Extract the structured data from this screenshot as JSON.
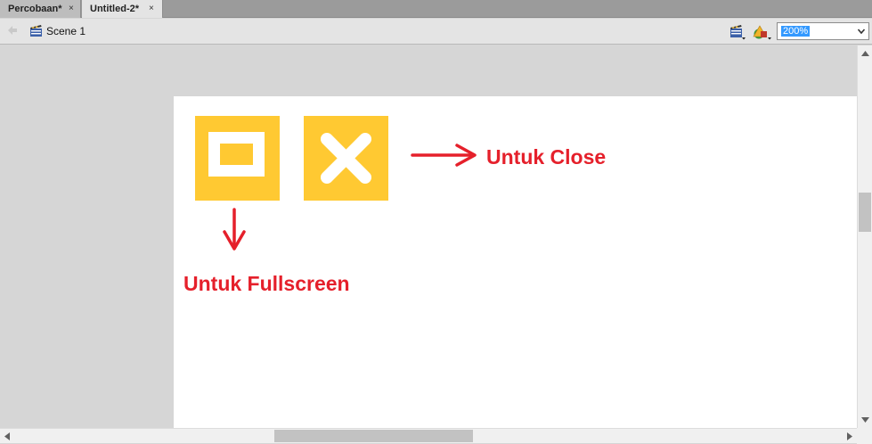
{
  "tabs": [
    {
      "label": "Percobaan*",
      "close": "×",
      "active": false
    },
    {
      "label": "Untitled-2*",
      "close": "×",
      "active": true
    }
  ],
  "toolbar": {
    "back_icon": "back-arrow-icon",
    "scene_icon": "clapperboard-icon",
    "scene_label": "Scene 1",
    "edit_scene_icon": "edit-scene-icon",
    "edit_symbol_icon": "edit-symbol-icon",
    "zoom": {
      "selected": "200%"
    }
  },
  "stage": {
    "fullscreen_button_icon": "fullscreen-icon",
    "close_button_icon": "close-x-icon",
    "label_close": "Untuk Close",
    "label_fullscreen": "Untuk Fullscreen"
  },
  "colors": {
    "button_fill": "#ffc932",
    "annotation_red": "#e5202b",
    "stage_bg": "#ffffff",
    "pasteboard": "#d6d6d6"
  }
}
